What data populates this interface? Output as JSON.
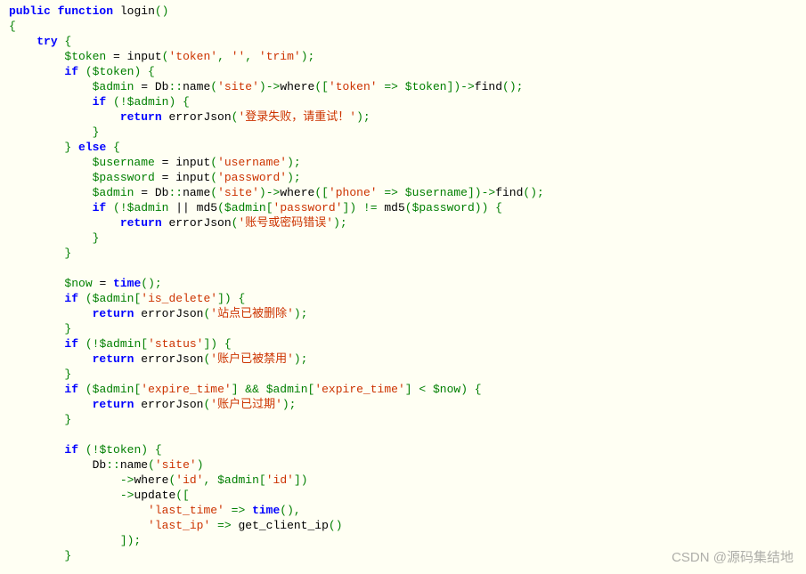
{
  "code": {
    "l01_public": "public",
    "l01_function": "function",
    "l01_name": "login",
    "l01_parens": "()",
    "l02_brace": "{",
    "l03_try": "try",
    "l03_brace": " {",
    "l04_var": "$token",
    "l04_eq": " = ",
    "l04_fn": "input",
    "l04_p1": "(",
    "l04_s1": "'token'",
    "l04_c1": ", ",
    "l04_s2": "''",
    "l04_c2": ", ",
    "l04_s3": "'trim'",
    "l04_p2": ");",
    "l05_if": "if",
    "l05_p1": " (",
    "l05_var": "$token",
    "l05_p2": ") {",
    "l06_var": "$admin",
    "l06_eq": " = ",
    "l06_db": "Db",
    "l06_dd": "::",
    "l06_name": "name",
    "l06_p1": "(",
    "l06_s1": "'site'",
    "l06_p2": ")->",
    "l06_where": "where",
    "l06_p3": "([",
    "l06_s2": "'token'",
    "l06_arrow": " => ",
    "l06_var2": "$token",
    "l06_p4": "])->",
    "l06_find": "find",
    "l06_p5": "();",
    "l07_if": "if",
    "l07_p1": " (!",
    "l07_var": "$admin",
    "l07_p2": ") {",
    "l08_return": "return",
    "l08_fn": " errorJson",
    "l08_p1": "(",
    "l08_s1": "'登录失败，请重试！'",
    "l08_p2": ");",
    "l09_brace": "}",
    "l10_brace1": "}",
    "l10_else": " else ",
    "l10_brace2": "{",
    "l11_var": "$username",
    "l11_eq": " = ",
    "l11_fn": "input",
    "l11_p1": "(",
    "l11_s1": "'username'",
    "l11_p2": ");",
    "l12_var": "$password",
    "l12_eq": " = ",
    "l12_fn": "input",
    "l12_p1": "(",
    "l12_s1": "'password'",
    "l12_p2": ");",
    "l13_var": "$admin",
    "l13_eq": " = ",
    "l13_db": "Db",
    "l13_dd": "::",
    "l13_name": "name",
    "l13_p1": "(",
    "l13_s1": "'site'",
    "l13_p2": ")->",
    "l13_where": "where",
    "l13_p3": "([",
    "l13_s2": "'phone'",
    "l13_arrow": " => ",
    "l13_var2": "$username",
    "l13_p4": "])->",
    "l13_find": "find",
    "l13_p5": "();",
    "l14_if": "if",
    "l14_p1": " (!",
    "l14_var1": "$admin",
    "l14_or": " || ",
    "l14_md5a": "md5",
    "l14_p2": "(",
    "l14_var2": "$admin",
    "l14_b1": "[",
    "l14_s1": "'password'",
    "l14_b2": "]) != ",
    "l14_md5b": "md5",
    "l14_p3": "(",
    "l14_var3": "$password",
    "l14_p4": ")) {",
    "l15_return": "return",
    "l15_fn": " errorJson",
    "l15_p1": "(",
    "l15_s1": "'账号或密码错误'",
    "l15_p2": ");",
    "l16_brace": "}",
    "l17_brace": "}",
    "l19_var": "$now",
    "l19_eq": " = ",
    "l19_fn": "time",
    "l19_p": "();",
    "l20_if": "if",
    "l20_p1": " (",
    "l20_var": "$admin",
    "l20_b1": "[",
    "l20_s1": "'is_delete'",
    "l20_b2": "]) {",
    "l21_return": "return",
    "l21_fn": " errorJson",
    "l21_p1": "(",
    "l21_s1": "'站点已被删除'",
    "l21_p2": ");",
    "l22_brace": "}",
    "l23_if": "if",
    "l23_p1": " (!",
    "l23_var": "$admin",
    "l23_b1": "[",
    "l23_s1": "'status'",
    "l23_b2": "]) {",
    "l24_return": "return",
    "l24_fn": " errorJson",
    "l24_p1": "(",
    "l24_s1": "'账户已被禁用'",
    "l24_p2": ");",
    "l25_brace": "}",
    "l26_if": "if",
    "l26_p1": " (",
    "l26_var1": "$admin",
    "l26_b1": "[",
    "l26_s1": "'expire_time'",
    "l26_b2": "] && ",
    "l26_var2": "$admin",
    "l26_b3": "[",
    "l26_s2": "'expire_time'",
    "l26_b4": "] < ",
    "l26_var3": "$now",
    "l26_p2": ") {",
    "l27_return": "return",
    "l27_fn": " errorJson",
    "l27_p1": "(",
    "l27_s1": "'账户已过期'",
    "l27_p2": ");",
    "l28_brace": "}",
    "l30_if": "if",
    "l30_p1": " (!",
    "l30_var": "$token",
    "l30_p2": ") {",
    "l31_db": "Db",
    "l31_dd": "::",
    "l31_name": "name",
    "l31_p1": "(",
    "l31_s1": "'site'",
    "l31_p2": ")",
    "l32_arrow": "->",
    "l32_where": "where",
    "l32_p1": "(",
    "l32_s1": "'id'",
    "l32_c": ", ",
    "l32_var": "$admin",
    "l32_b1": "[",
    "l32_s2": "'id'",
    "l32_b2": "])",
    "l33_arrow": "->",
    "l33_update": "update",
    "l33_p": "([",
    "l34_s1": "'last_time'",
    "l34_arrow": " => ",
    "l34_fn": "time",
    "l34_p": "(),",
    "l35_s1": "'last_ip'",
    "l35_arrow": " => ",
    "l35_fn": "get_client_ip",
    "l35_p": "()",
    "l36_p": "]);",
    "l37_brace": "}"
  },
  "watermark": "CSDN @源码集结地"
}
